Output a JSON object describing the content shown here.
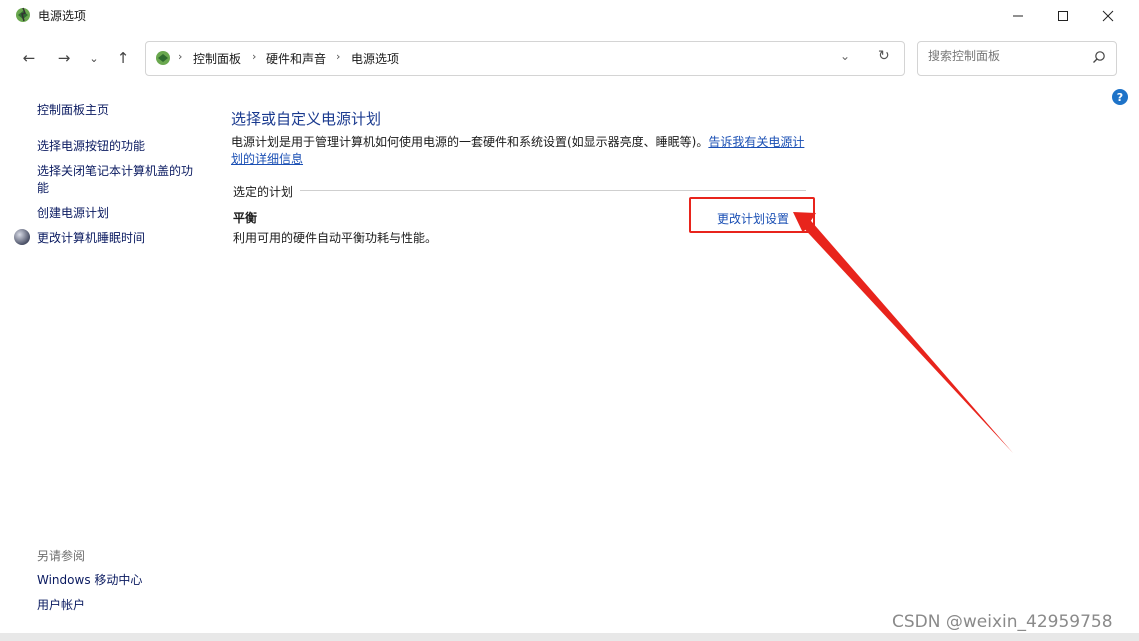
{
  "window": {
    "title": "电源选项"
  },
  "address": {
    "crumbs": [
      "控制面板",
      "硬件和声音",
      "电源选项"
    ]
  },
  "search": {
    "placeholder": "搜索控制面板"
  },
  "sidebar": {
    "home": "控制面板主页",
    "links": [
      "选择电源按钮的功能",
      "选择关闭笔记本计算机盖的功能",
      "创建电源计划",
      "更改计算机睡眠时间"
    ],
    "see_also_title": "另请参阅",
    "see_also": [
      "Windows 移动中心",
      "用户帐户"
    ]
  },
  "main": {
    "title": "选择或自定义电源计划",
    "description": "电源计划是用于管理计算机如何使用电源的一套硬件和系统设置(如显示器亮度、睡眠等)。",
    "description_link": "告诉我有关电源计划的详细信息",
    "section_label": "选定的计划",
    "plan_name": "平衡",
    "plan_description": "利用可用的硬件自动平衡功耗与性能。",
    "change_link": "更改计划设置"
  },
  "annotation_color": "#e8241c",
  "watermark": "CSDN @weixin_42959758"
}
